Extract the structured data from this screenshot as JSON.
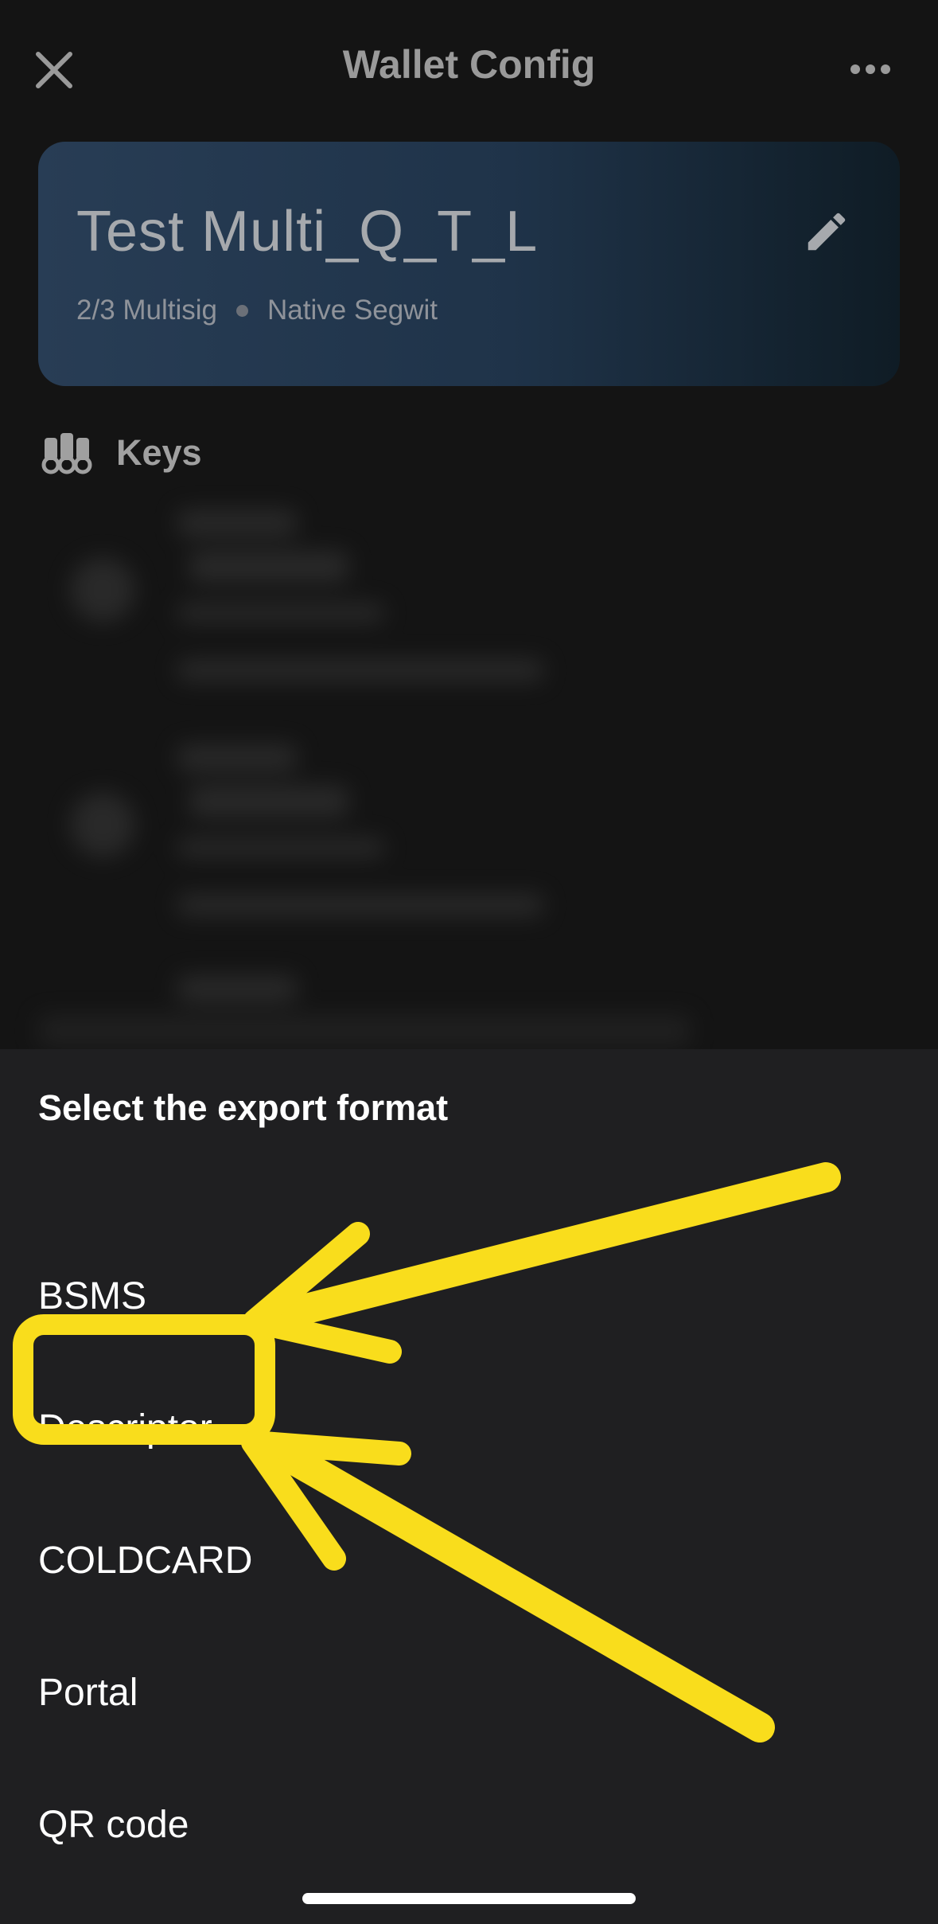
{
  "header": {
    "title": "Wallet Config",
    "close_icon": "close-icon",
    "more_icon": "more-horizontal-icon"
  },
  "wallet": {
    "name": "Test Multi_Q_T_L",
    "type": "2/3 Multisig",
    "address_type": "Native Segwit",
    "edit_icon": "pencil-icon"
  },
  "keys_section": {
    "label": "Keys",
    "icon": "keys-icon"
  },
  "export_sheet": {
    "title": "Select the export format",
    "options": [
      {
        "label": "BSMS"
      },
      {
        "label": "Descriptor"
      },
      {
        "label": "COLDCARD"
      },
      {
        "label": "Portal"
      },
      {
        "label": "QR code"
      }
    ]
  },
  "annotation": {
    "highlight_color": "#f9dd1c",
    "highlighted_option": "Descriptor"
  },
  "colors": {
    "background": "#141414",
    "sheet": "#1f1f21",
    "card_start": "#283d55",
    "card_end": "#0f1c25"
  }
}
